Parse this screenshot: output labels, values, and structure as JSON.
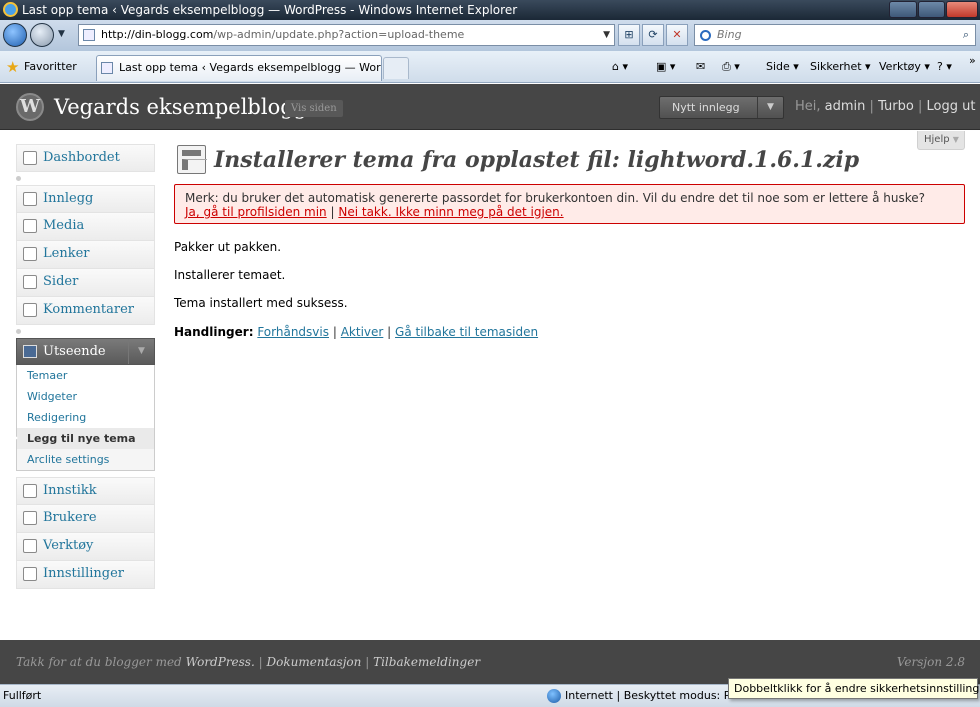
{
  "browser": {
    "window_title": "Last opp tema ‹ Vegards eksempelblogg — WordPress - Windows Internet Explorer",
    "url_host": "http://din-blogg.com",
    "url_path": "/wp-admin/update.php?action=upload-theme",
    "search_placeholder": "Bing",
    "favorites_label": "Favoritter",
    "tab_title": "Last opp tema ‹ Vegards eksempelblogg — Word...",
    "command_bar": {
      "page": "Side ▾",
      "safety": "Sikkerhet ▾",
      "tools": "Verktøy ▾"
    },
    "status_text": "Fullført",
    "zone_text": "Internett | Beskyttet modus: På",
    "tooltip": "Dobbeltklikk for å endre sikkerhetsinnstillingene"
  },
  "wp_header": {
    "blog_name": "Vegards eksempelblogg",
    "visit_site": "Vis siden",
    "new_post": "Nytt innlegg",
    "greeting": "Hei,",
    "user": "admin",
    "sep1": "|",
    "turbo": "Turbo",
    "sep2": "|",
    "logout": "Logg ut"
  },
  "menu": {
    "dashboard": "Dashbordet",
    "posts": "Innlegg",
    "media": "Media",
    "links": "Lenker",
    "pages": "Sider",
    "comments": "Kommentarer",
    "appearance": "Utseende",
    "appearance_sub": [
      "Temaer",
      "Widgeter",
      "Redigering",
      "Legg til nye tema",
      "Arclite settings"
    ],
    "plugins": "Innstikk",
    "users": "Brukere",
    "tools": "Verktøy",
    "settings": "Innstillinger"
  },
  "help_label": "Hjelp",
  "page_title": "Installerer tema fra opplastet fil: lightword.1.6.1.zip",
  "notice": {
    "text": "Merk: du bruker det automatisk genererte passordet for brukerkontoen din. Vil du endre det til noe som er lettere å huske?",
    "link_yes": "Ja, gå til profilsiden min",
    "sep": "|",
    "link_no": "Nei takk. Ikke minn meg på det igjen."
  },
  "progress": {
    "step1": "Pakker ut pakken.",
    "step2": "Installerer temaet.",
    "step3": "Tema installert med suksess."
  },
  "actions": {
    "label": "Handlinger:",
    "preview": "Forhåndsvis",
    "activate": "Aktiver",
    "back": "Gå tilbake til temasiden",
    "sep": "|"
  },
  "footer": {
    "thanks": "Takk for at du blogger med",
    "wordpress": "WordPress.",
    "docs": "Dokumentasjon",
    "feedback": "Tilbakemeldinger",
    "sep": "|",
    "version": "Versjon 2.8"
  }
}
